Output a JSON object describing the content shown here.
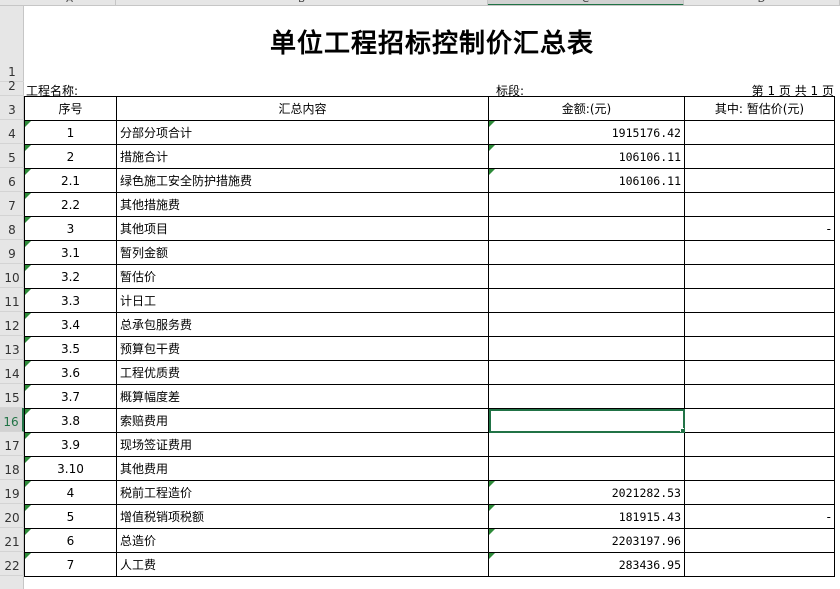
{
  "col_headers": [
    "A",
    "B",
    "C",
    "D",
    "E",
    "F"
  ],
  "row_numbers": [
    "1",
    "2",
    "3",
    "4",
    "5",
    "6",
    "7",
    "8",
    "9",
    "10",
    "11",
    "12",
    "13",
    "14",
    "15",
    "16",
    "17",
    "18",
    "19",
    "20",
    "21",
    "22"
  ],
  "selected_row": "16",
  "title": "单位工程招标控制价汇总表",
  "project_label": "工程名称:",
  "section_label": "标段:",
  "page_label": "第 1 页  共 1 页",
  "headers": {
    "seq": "序号",
    "content": "汇总内容",
    "amount": "金额:(元)",
    "estimate": "其中: 暂估价(元)"
  },
  "rows": [
    {
      "seq": "1",
      "content": "分部分项合计",
      "amount": "1915176.42",
      "estimate": ""
    },
    {
      "seq": "2",
      "content": "措施合计",
      "amount": "106106.11",
      "estimate": ""
    },
    {
      "seq": "2.1",
      "content": "绿色施工安全防护措施费",
      "amount": "106106.11",
      "estimate": ""
    },
    {
      "seq": "2.2",
      "content": "其他措施费",
      "amount": "",
      "estimate": ""
    },
    {
      "seq": "3",
      "content": "其他项目",
      "amount": "",
      "estimate": "-"
    },
    {
      "seq": "3.1",
      "content": "暂列金额",
      "amount": "",
      "estimate": ""
    },
    {
      "seq": "3.2",
      "content": "暂估价",
      "amount": "",
      "estimate": ""
    },
    {
      "seq": "3.3",
      "content": "计日工",
      "amount": "",
      "estimate": ""
    },
    {
      "seq": "3.4",
      "content": "总承包服务费",
      "amount": "",
      "estimate": ""
    },
    {
      "seq": "3.5",
      "content": "预算包干费",
      "amount": "",
      "estimate": ""
    },
    {
      "seq": "3.6",
      "content": "工程优质费",
      "amount": "",
      "estimate": ""
    },
    {
      "seq": "3.7",
      "content": "概算幅度差",
      "amount": "",
      "estimate": ""
    },
    {
      "seq": "3.8",
      "content": "索赔费用",
      "amount": "",
      "estimate": ""
    },
    {
      "seq": "3.9",
      "content": "现场签证费用",
      "amount": "",
      "estimate": ""
    },
    {
      "seq": "3.10",
      "content": "其他费用",
      "amount": "",
      "estimate": ""
    },
    {
      "seq": "4",
      "content": "税前工程造价",
      "amount": "2021282.53",
      "estimate": ""
    },
    {
      "seq": "5",
      "content": "增值税销项税额",
      "amount": "181915.43",
      "estimate": "-"
    },
    {
      "seq": "6",
      "content": "总造价",
      "amount": "2203197.96",
      "estimate": ""
    },
    {
      "seq": "7",
      "content": "人工费",
      "amount": "283436.95",
      "estimate": ""
    }
  ]
}
